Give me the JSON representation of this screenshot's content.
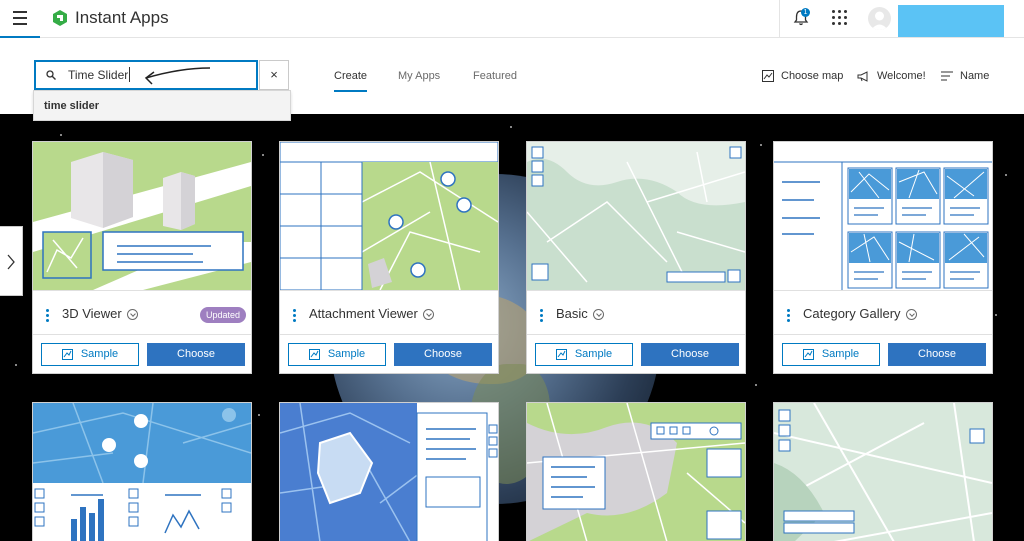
{
  "header": {
    "app_title": "Instant Apps",
    "notification_count": "1"
  },
  "search": {
    "value": "Time Slider",
    "clear_symbol": "×",
    "suggestion": "time slider"
  },
  "tabs": [
    {
      "label": "Create",
      "active": true
    },
    {
      "label": "My Apps",
      "active": false
    },
    {
      "label": "Featured",
      "active": false
    }
  ],
  "tools": {
    "choose_map": "Choose map",
    "welcome": "Welcome!",
    "sort": "Name"
  },
  "cards": [
    {
      "title": "3D Viewer",
      "badge": "Updated",
      "sample_label": "Sample",
      "choose_label": "Choose"
    },
    {
      "title": "Attachment Viewer",
      "sample_label": "Sample",
      "choose_label": "Choose"
    },
    {
      "title": "Basic",
      "sample_label": "Sample",
      "choose_label": "Choose"
    },
    {
      "title": "Category Gallery",
      "sample_label": "Sample",
      "choose_label": "Choose"
    }
  ],
  "icons": {
    "menu": "hamburger-icon",
    "logo": "instant-apps-logo-icon",
    "bell": "bell-icon",
    "apps": "app-launcher-icon",
    "search": "search-icon",
    "choose_map": "map-icon",
    "welcome": "megaphone-icon",
    "sort": "sort-icon",
    "info": "chevron-circle-icon",
    "sample": "map-sample-icon",
    "side_toggle": "chevron-right-icon"
  },
  "colors": {
    "accent": "#007ac2",
    "choose_button": "#2e73c0",
    "updated_badge": "#9e7fc0",
    "map_green": "#b8d98c",
    "map_blue": "#4a9ad8",
    "map_sage": "#c9dfce"
  }
}
